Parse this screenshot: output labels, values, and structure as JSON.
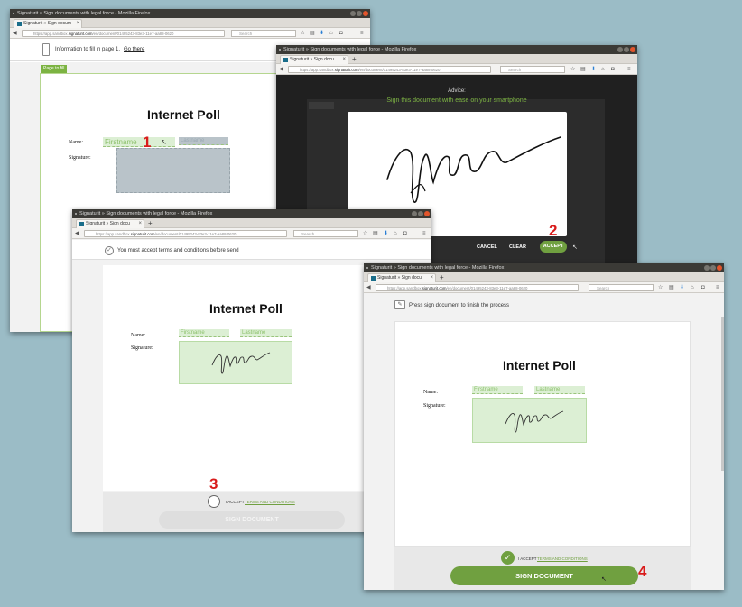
{
  "win1": {
    "title": "Signaturit » Sign documents with legal force - Mozilla Firefox",
    "tab": "Signaturit » Sign docum",
    "url_prefix": "https://app.sandbox.",
    "url_domain": "signaturit.com",
    "url_rest": "/en/document/01495243-83e3-11e7-aa88-0620",
    "search": "Search",
    "info_text": "Information to fill in page 1.",
    "go_there": "Go there",
    "page_tag": "Page to fill",
    "doc_title": "Internet Poll",
    "name_label": "Name:",
    "signature_label": "Signature:",
    "firstname": "Firstname",
    "lastname": "Lastname",
    "marker": "1"
  },
  "win2": {
    "title": "Signaturit » Sign documents with legal force - Mozilla Firefox",
    "tab": "Signaturit » Sign docu",
    "url_prefix": "https://app.sandbox.",
    "url_domain": "signaturit.com",
    "url_rest": "/en/document/01495243-83e3-11e7-aa88-0620",
    "search": "Search",
    "advice_label": "Advice:",
    "advice_text": "Sign this document with ease on your smartphone",
    "cancel": "CANCEL",
    "clear": "CLEAR",
    "accept": "ACCEPT",
    "marker": "2"
  },
  "win3": {
    "title": "Signaturit » Sign documents with legal force - Mozilla Firefox",
    "tab": "Signaturit » Sign docu",
    "url_prefix": "https://app.sandbox.",
    "url_domain": "signaturit.com",
    "url_rest": "/en/document/01495243-83e3-11e7-aa88-0620",
    "search": "Search",
    "notice": "You must accept terms and conditions before send",
    "doc_title": "Internet Poll",
    "name_label": "Name:",
    "signature_label": "Signature:",
    "firstname": "Firstname",
    "lastname": "Lastname",
    "accept_prefix": "I ACCEPT",
    "terms": "TERMS AND CONDITIONS",
    "sign_button": "SIGN DOCUMENT",
    "marker": "3"
  },
  "win4": {
    "title": "Signaturit » Sign documents with legal force - Mozilla Firefox",
    "tab": "Signaturit » Sign docu",
    "url_prefix": "https://app.sandbox.",
    "url_domain": "signaturit.com",
    "url_rest": "/en/document/01495243-83e3-11e7-aa88-0620",
    "search": "Search",
    "notice": "Press sign document to finish the process",
    "doc_title": "Internet Poll",
    "name_label": "Name:",
    "signature_label": "Signature:",
    "firstname": "Firstname",
    "lastname": "Lastname",
    "accept_prefix": "I ACCEPT",
    "terms": "TERMS AND CONDITIONS",
    "sign_button": "SIGN DOCUMENT",
    "marker": "4"
  },
  "colors": {
    "brand_green": "#70a040",
    "marker_red": "#d91b1b",
    "field_green": "#dcefd4",
    "field_grey": "#b9c3c9"
  }
}
